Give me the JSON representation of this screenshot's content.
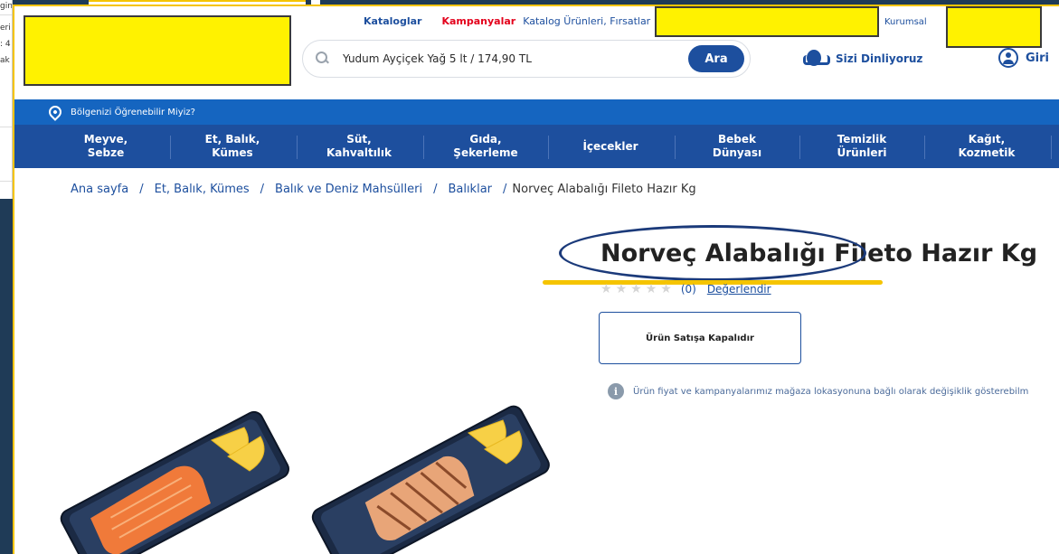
{
  "background_window": {
    "lines": [
      "gindir",
      "eri",
      ": 4",
      "ak"
    ]
  },
  "header": {
    "top_links": [
      {
        "label": "Kataloglar",
        "style": "blue"
      },
      {
        "label": "Kampanyalar",
        "style": "red"
      },
      {
        "label": "Katalog Ürünleri, Fırsatlar",
        "style": "gray"
      }
    ],
    "kurumsal": "Kurumsal",
    "search": {
      "placeholder": "Yudum Ayçiçek Yağ 5 lt / 174,90 TL",
      "button": "Ara",
      "icon": "search-icon"
    },
    "listen": {
      "label": "Sizi Dinliyoruz",
      "icon": "headset-icon"
    },
    "login": {
      "label": "Giri",
      "icon": "user-icon"
    }
  },
  "region": {
    "label": "Bölgenizi Öğrenebilir Miyiz?",
    "icon": "location-pin-icon"
  },
  "categories": [
    {
      "label": "Meyve,\nSebze"
    },
    {
      "label": "Et, Balık,\nKümes"
    },
    {
      "label": "Süt,\nKahvaltılık"
    },
    {
      "label": "Gıda,\nŞekerleme"
    },
    {
      "label": "İçecekler"
    },
    {
      "label": "Bebek\nDünyası"
    },
    {
      "label": "Temizlik\nÜrünleri"
    },
    {
      "label": "Kağıt,\nKozmetik"
    }
  ],
  "breadcrumb": {
    "items": [
      "Ana sayfa",
      "Et, Balık, Kümes",
      "Balık ve Deniz Mahsülleri",
      "Balıklar"
    ],
    "current": "Norveç Alabalığı Fileto Hazır Kg"
  },
  "product": {
    "title": "Norveç Alabalığı Fileto Hazır Kg",
    "rating_count": "(0)",
    "rate_link": "Değerlendir",
    "status_button": "Ürün Satışa Kapalıdır",
    "info_text": "Ürün fiyat ve kampanyalarımız mağaza lokasyonuna bağlı olarak değişiklik gösterebilm",
    "stars": 5,
    "rating_value": 0
  },
  "colors": {
    "brand_blue": "#1d4f9e",
    "region_blue": "#1565c0",
    "red": "#e3001b",
    "highlight_yellow": "#fff200",
    "annotation_yellow": "#f5c400"
  }
}
